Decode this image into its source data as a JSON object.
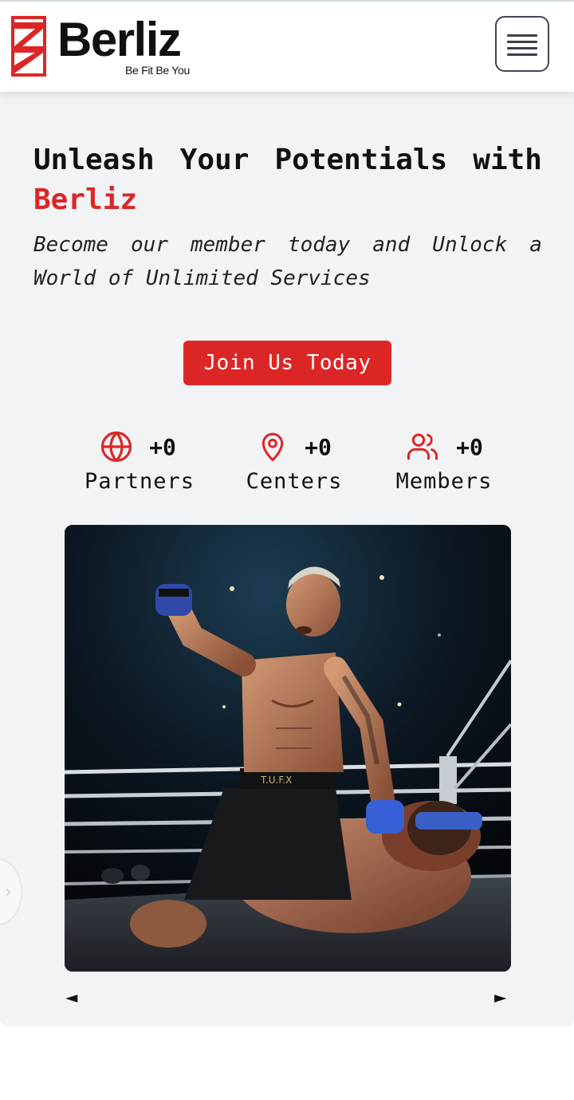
{
  "header": {
    "logo_word": "Berliz",
    "logo_tagline": "Be Fit Be You",
    "menu_icon": "hamburger-icon"
  },
  "hero": {
    "title_words": [
      "Unleash",
      "Your",
      "Potentials",
      "with"
    ],
    "title_brand": "Berliz",
    "subtitle_line1_words": [
      "Become",
      "our",
      "member",
      "today",
      "and",
      "Unlock",
      "a"
    ],
    "subtitle_line2": "World of Unlimited Services",
    "cta_label": "Join Us Today"
  },
  "stats": [
    {
      "icon": "globe-icon",
      "value": "+0",
      "label": "Partners"
    },
    {
      "icon": "map-pin-icon",
      "value": "+0",
      "label": "Centers"
    },
    {
      "icon": "users-icon",
      "value": "+0",
      "label": "Members"
    }
  ],
  "carousel": {
    "prev_arrow": "◄",
    "next_arrow": "►",
    "side_handle": "›"
  },
  "colors": {
    "accent": "#dc2626",
    "hero_background": "#f2f3f5",
    "text": "#111111"
  }
}
